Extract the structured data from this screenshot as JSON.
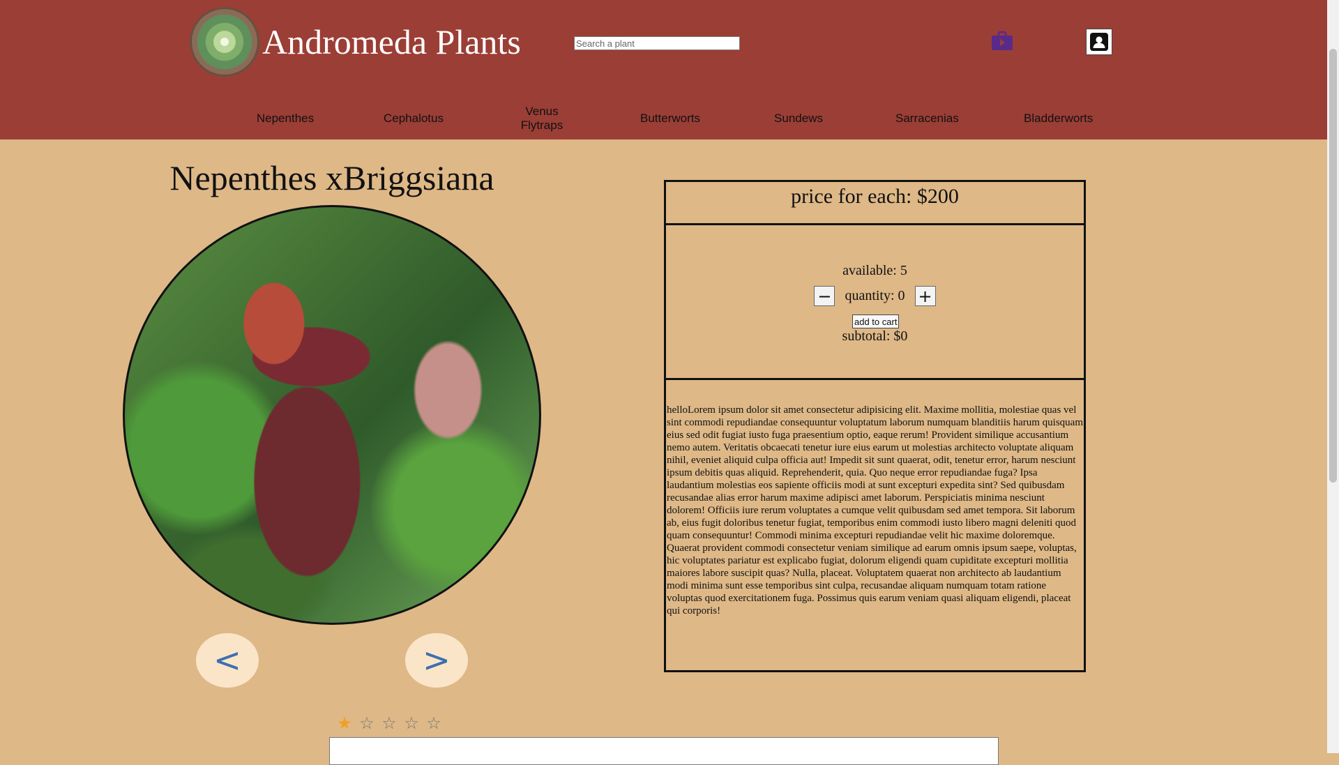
{
  "header": {
    "brand": "Andromeda Plants",
    "search_placeholder": "Search a plant",
    "nav": [
      "Nepenthes",
      "Cephalotus",
      "Venus Flytraps",
      "Butterworts",
      "Sundews",
      "Sarracenias",
      "Bladderworts"
    ],
    "colors": {
      "header_bg": "#9b3e36",
      "page_bg": "#deb887",
      "cart_icon": "#5a2a8a"
    }
  },
  "product": {
    "title": "Nepenthes xBriggsiana",
    "prev_label": "<",
    "next_label": ">",
    "price_text": "price for each: $200",
    "available_text": "available: 5",
    "quantity_text": "quantity: 0",
    "minus_label": "−",
    "plus_label": "+",
    "add_to_cart_label": "add to cart",
    "subtotal_text": "subtotal: $0",
    "description": "helloLorem ipsum dolor sit amet consectetur adipisicing elit. Maxime mollitia, molestiae quas vel sint commodi repudiandae consequuntur voluptatum laborum numquam blanditiis harum quisquam eius sed odit fugiat iusto fuga praesentium optio, eaque rerum! Provident similique accusantium nemo autem. Veritatis obcaecati tenetur iure eius earum ut molestias architecto voluptate aliquam nihil, eveniet aliquid culpa officia aut! Impedit sit sunt quaerat, odit, tenetur error, harum nesciunt ipsum debitis quas aliquid. Reprehenderit, quia. Quo neque error repudiandae fuga? Ipsa laudantium molestias eos sapiente officiis modi at sunt excepturi expedita sint? Sed quibusdam recusandae alias error harum maxime adipisci amet laborum. Perspiciatis minima nesciunt dolorem! Officiis iure rerum voluptates a cumque velit quibusdam sed amet tempora. Sit laborum ab, eius fugit doloribus tenetur fugiat, temporibus enim commodi iusto libero magni deleniti quod quam consequuntur! Commodi minima excepturi repudiandae velit hic maxime doloremque. Quaerat provident commodi consectetur veniam similique ad earum omnis ipsum saepe, voluptas, hic voluptates pariatur est explicabo fugiat, dolorum eligendi quam cupiditate excepturi mollitia maiores labore suscipit quas? Nulla, placeat. Voluptatem quaerat non architecto ab laudantium modi minima sunt esse temporibus sint culpa, recusandae aliquam numquam totam ratione voluptas quod exercitationem fuga. Possimus quis earum veniam quasi aliquam eligendi, placeat qui corporis!"
  },
  "rating": {
    "stars": [
      "★",
      "☆",
      "☆",
      "☆",
      "☆"
    ],
    "value": 1,
    "max": 5
  }
}
